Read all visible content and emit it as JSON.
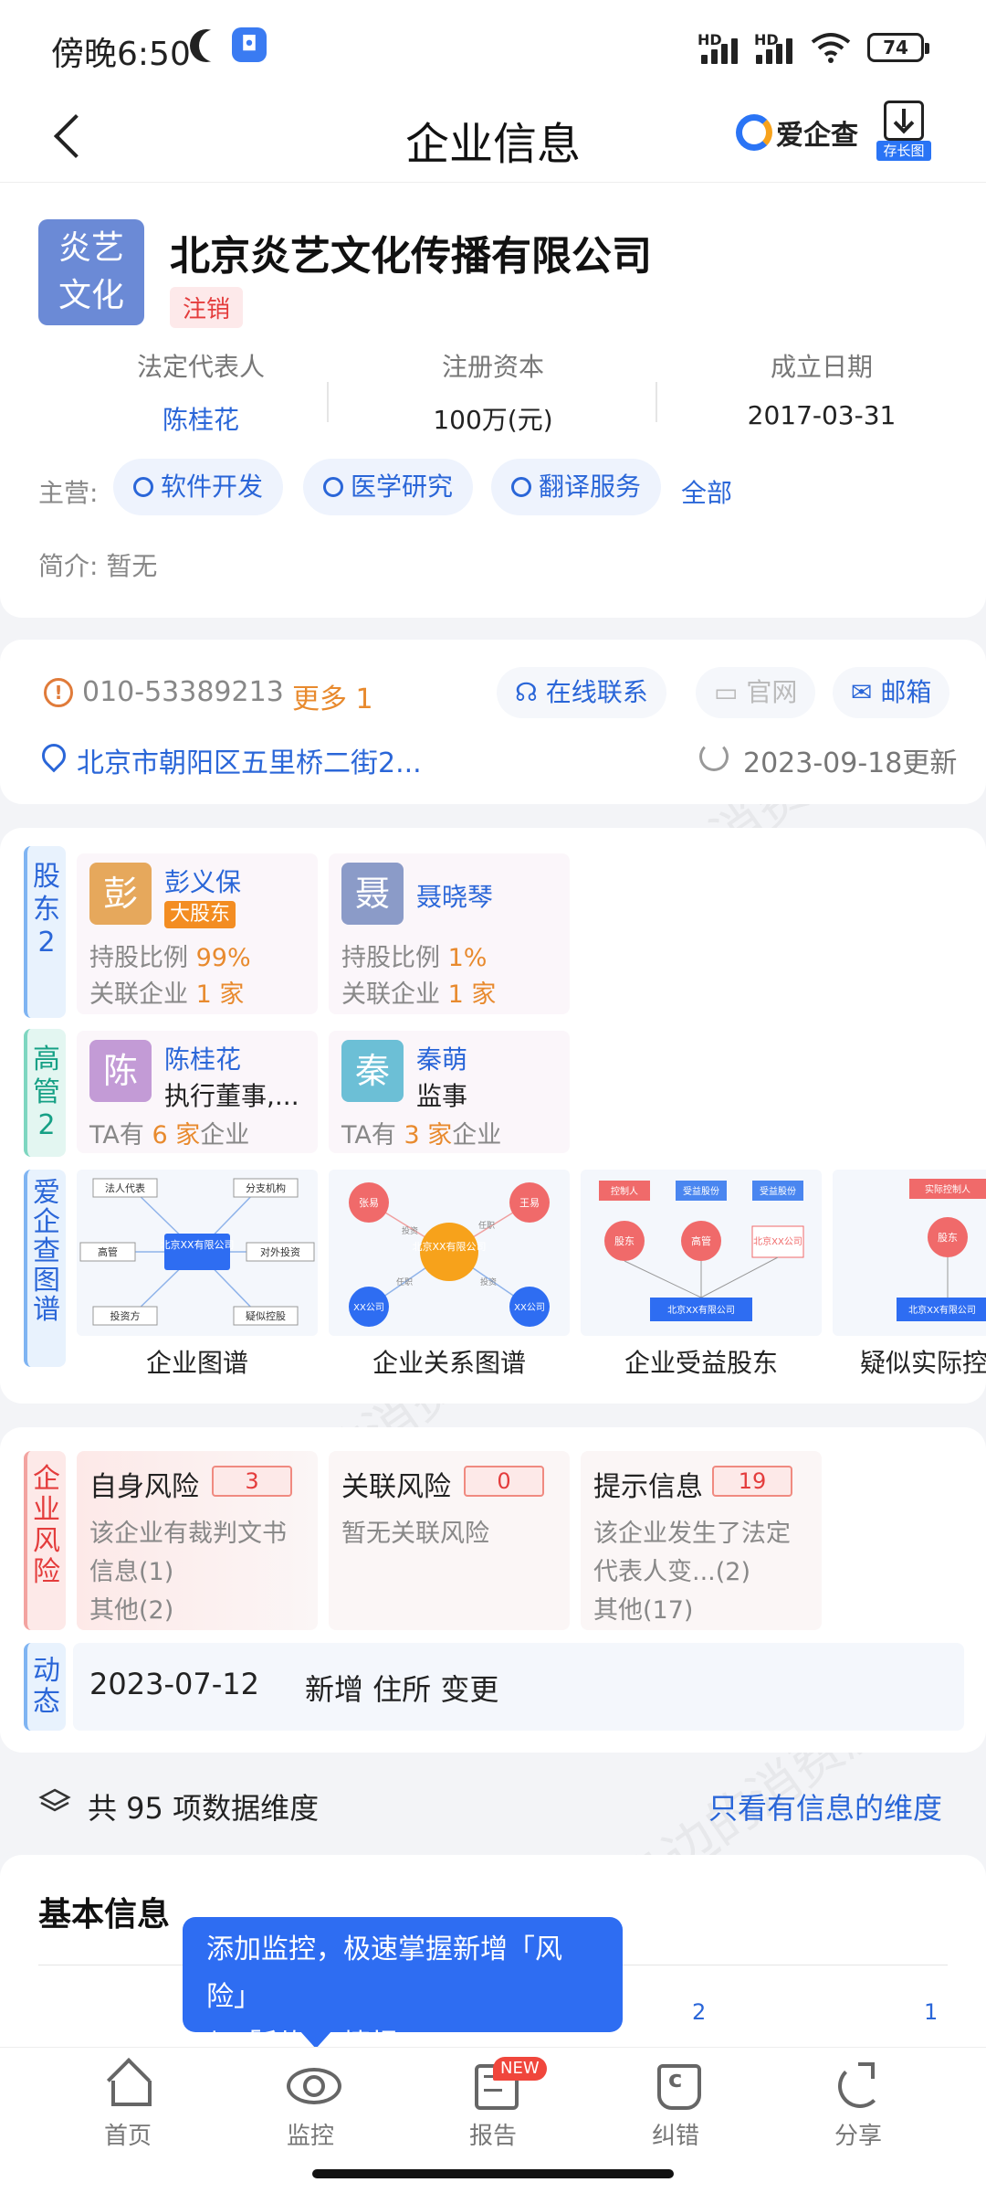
{
  "status_bar": {
    "time": "傍晚6:50",
    "battery": "74",
    "net1": "HD",
    "net2": "HD"
  },
  "header": {
    "title": "企业信息",
    "brand": "爱企查",
    "save_image": "存长图"
  },
  "company": {
    "logo_line1": "炎艺",
    "logo_line2": "文化",
    "name": "北京炎艺文化传播有限公司",
    "status": "注销",
    "info": [
      {
        "label": "法定代表人",
        "value": "陈桂花"
      },
      {
        "label": "注册资本",
        "value": "100万(元)"
      },
      {
        "label": "成立日期",
        "value": "2017-03-31"
      }
    ],
    "main_business_label": "主营:",
    "business_tags": [
      "软件开发",
      "医学研究",
      "翻译服务"
    ],
    "all_label": "全部",
    "intro": "简介: 暂无"
  },
  "contact": {
    "phone": "010-53389213",
    "more": "更多 1",
    "online": "在线联系",
    "website": "官网",
    "email": "邮箱",
    "address": "北京市朝阳区五里桥二街2...",
    "updated": "2023-09-18更新"
  },
  "shareholders": {
    "label": "股东2",
    "items": [
      {
        "avatar": "彭",
        "name": "彭义保",
        "tag": "大股东",
        "ratio_label": "持股比例",
        "ratio": "99%",
        "rel_label": "关联企业",
        "rel": "1 家"
      },
      {
        "avatar": "聂",
        "name": "聂晓琴",
        "tag": "",
        "ratio_label": "持股比例",
        "ratio": "1%",
        "rel_label": "关联企业",
        "rel": "1 家"
      }
    ]
  },
  "executives": {
    "label": "高管2",
    "items": [
      {
        "avatar": "陈",
        "name": "陈桂花",
        "role": "执行董事,...",
        "ta_pre": "TA有",
        "count": "6 家",
        "ta_post": "企业"
      },
      {
        "avatar": "秦",
        "name": "秦萌",
        "role": "监事",
        "ta_pre": "TA有",
        "count": "3 家",
        "ta_post": "企业"
      }
    ]
  },
  "graphs": {
    "label": "爱企查图谱",
    "items": [
      {
        "title": "企业图谱",
        "center": "北京XX有限公司",
        "nodes": [
          "法人代表",
          "分支机构",
          "高管",
          "对外投资",
          "投资方",
          "疑似控股"
        ]
      },
      {
        "title": "企业关系图谱",
        "center": "北京XX有限公司",
        "nodes": [
          "张易",
          "王易",
          "XX公司",
          "XX公司"
        ],
        "edges": [
          "投资",
          "任职",
          "任职",
          "投资"
        ]
      },
      {
        "title": "企业受益股东",
        "center": "北京XX有限公司",
        "nodes": [
          "控制人",
          "受益股份",
          "受益股份",
          "股东",
          "高管",
          "北京XX公司"
        ]
      },
      {
        "title": "疑似实际控",
        "center": "北京XX有限公司",
        "nodes": [
          "实际控制人",
          "股东"
        ]
      }
    ]
  },
  "risk": {
    "label": "企业风险",
    "items": [
      {
        "title": "自身风险",
        "count": "3",
        "desc": [
          "该企业有裁判文书",
          "信息(1)",
          "其他(2)"
        ]
      },
      {
        "title": "关联风险",
        "count": "0",
        "desc": [
          "暂无关联风险"
        ]
      },
      {
        "title": "提示信息",
        "count": "19",
        "desc": [
          "该企业发生了法定",
          "代表人变...(2)",
          "其他(17)"
        ]
      }
    ]
  },
  "dynamic": {
    "label": "动态",
    "date": "2023-07-12",
    "text": "新增 住所 变更"
  },
  "dimensions": {
    "text": "共 95 项数据维度",
    "link": "只看有信息的维度"
  },
  "basic": {
    "title": "基本信息",
    "count_a": "2",
    "count_b": "1"
  },
  "tooltip": {
    "line1": "添加监控，极速掌握新增「风险」",
    "line2": "与「利好」情报"
  },
  "nav": {
    "items": [
      "首页",
      "监控",
      "报告",
      "纠错",
      "分享"
    ],
    "new_badge": "NEW"
  },
  "watermark": "消费保 您身边的消费服务管家"
}
